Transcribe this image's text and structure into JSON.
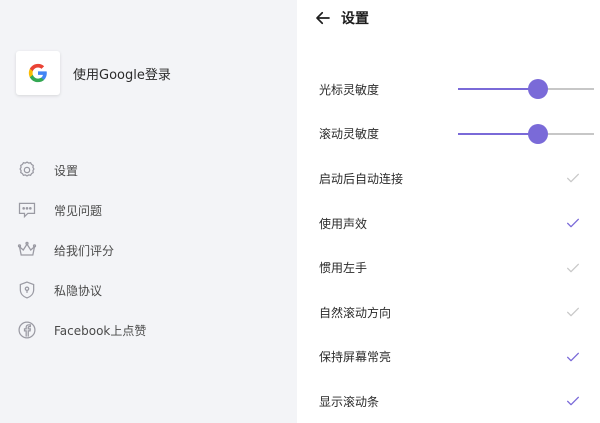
{
  "sidebar": {
    "signin_label": "使用Google登录",
    "menu": [
      {
        "icon": "gear-icon",
        "label": "设置"
      },
      {
        "icon": "chat-icon",
        "label": "常见问题"
      },
      {
        "icon": "crown-icon",
        "label": "给我们评分"
      },
      {
        "icon": "shield-icon",
        "label": "私隐协议"
      },
      {
        "icon": "facebook-icon",
        "label": "Facebook上点赞"
      }
    ]
  },
  "settings": {
    "title": "设置",
    "sliders": [
      {
        "label": "光标灵敏度",
        "value": 0.59
      },
      {
        "label": "滚动灵敏度",
        "value": 0.59
      }
    ],
    "toggles": [
      {
        "label": "启动后自动连接",
        "checked": false
      },
      {
        "label": "使用声效",
        "checked": true
      },
      {
        "label": "惯用左手",
        "checked": false
      },
      {
        "label": "自然滚动方向",
        "checked": false
      },
      {
        "label": "保持屏幕常亮",
        "checked": true
      },
      {
        "label": "显示滚动条",
        "checked": true
      }
    ]
  },
  "colors": {
    "accent": "#7a6ad8",
    "unchecked": "#c9c9c9",
    "sidebar_bg": "#f3f4f7"
  }
}
